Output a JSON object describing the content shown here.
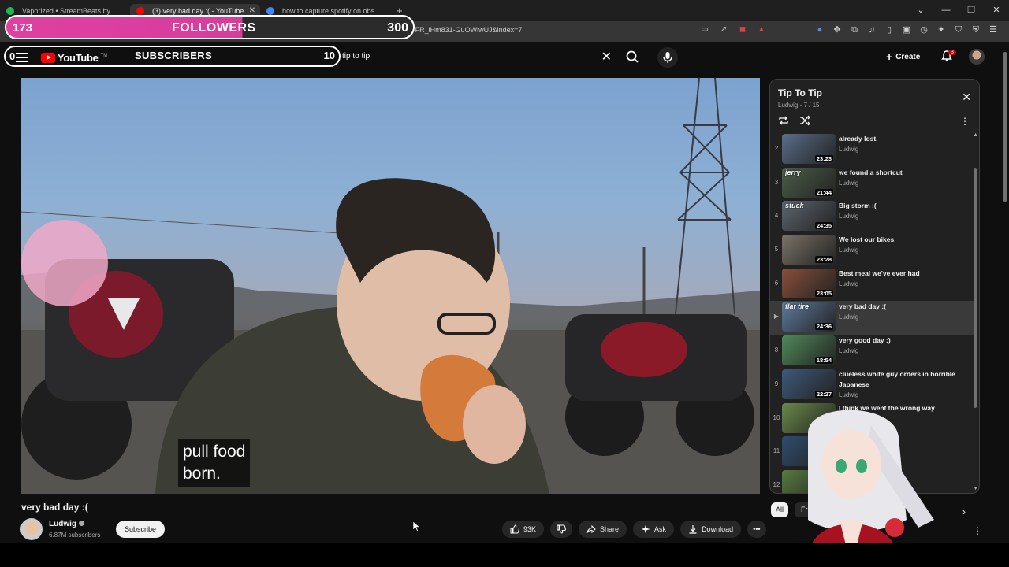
{
  "browser": {
    "tabs": [
      {
        "title": "Vaporized • StreamBeats by Harri",
        "fav_color": "#1db954",
        "active": false
      },
      {
        "title": "(3) very bad day :( - YouTube",
        "fav_color": "#ff0000",
        "active": true
      },
      {
        "title": "how to capture spotify on obs - Goo",
        "fav_color": "#4285f4",
        "active": false
      }
    ],
    "url": "be.com/watch?v=0yj7sQqq3nY&list=PLLGT0cbnpCyg_YFR_iHm831-GuOWlwUJ&index=7"
  },
  "overlay": {
    "followers_count": "173",
    "followers_label": "FOLLOWERS",
    "followers_goal": "300",
    "followers_progress": 0.58,
    "subs_count": "0",
    "subs_label": "SUBSCRIBERS",
    "subs_goal": "10"
  },
  "masthead": {
    "logo_text": "YouTube",
    "logo_tm": "TM",
    "search_value": "tip to tip",
    "create_label": "Create",
    "notif_count": "3"
  },
  "video": {
    "caption_line1": "pull food",
    "caption_line2": "born.",
    "title": "very bad day :(",
    "channel": "Ludwig",
    "subscribers": "6.87M subscribers",
    "subscribe_label": "Subscribe",
    "likes": "93K",
    "share_label": "Share",
    "ask_label": "Ask",
    "download_label": "Download"
  },
  "playlist": {
    "title": "Tip To Tip",
    "subtitle": "Ludwig - 7 / 15",
    "items": [
      {
        "index": "2",
        "title": "already lost.",
        "author": "Ludwig",
        "duration": "23:23",
        "thumb_text": "",
        "bg": "#5a6e8a",
        "current": false
      },
      {
        "index": "3",
        "title": "we found a shortcut",
        "author": "Ludwig",
        "duration": "21:44",
        "thumb_text": "jerry",
        "bg": "#4c5f4a",
        "current": false
      },
      {
        "index": "4",
        "title": "Big storm :(",
        "author": "Ludwig",
        "duration": "24:35",
        "thumb_text": "stuck",
        "bg": "#5d6670",
        "current": false
      },
      {
        "index": "5",
        "title": "We lost our bikes",
        "author": "Ludwig",
        "duration": "23:28",
        "thumb_text": "",
        "bg": "#7a7368",
        "current": false
      },
      {
        "index": "6",
        "title": "Best meal we've ever had",
        "author": "Ludwig",
        "duration": "23:05",
        "thumb_text": "",
        "bg": "#8a4f3a",
        "current": false
      },
      {
        "index": "▶",
        "title": "very bad day :(",
        "author": "Ludwig",
        "duration": "24:36",
        "thumb_text": "flat tire",
        "bg": "#5e7b9e",
        "current": true
      },
      {
        "index": "8",
        "title": "very good day :)",
        "author": "Ludwig",
        "duration": "18:54",
        "thumb_text": "",
        "bg": "#4f8a5a",
        "current": false
      },
      {
        "index": "9",
        "title": "clueless white guy orders in horrible Japanese",
        "author": "Ludwig",
        "duration": "22:27",
        "thumb_text": "",
        "bg": "#3d5a7a",
        "current": false
      },
      {
        "index": "10",
        "title": "I think we went the wrong way",
        "author": "",
        "duration": "",
        "thumb_text": "",
        "bg": "#6a8a4a",
        "current": false
      },
      {
        "index": "11",
        "title": "",
        "author": "",
        "duration": "",
        "thumb_text": "",
        "bg": "#2e4d6e",
        "current": false
      },
      {
        "index": "12",
        "title": "",
        "author": "",
        "duration": "",
        "thumb_text": "",
        "bg": "#587a3e",
        "current": false
      }
    ]
  },
  "chips": {
    "all": "All",
    "second": "Fr"
  },
  "colors": {
    "accent_red": "#ff0000",
    "followers_bar": "#e040a0",
    "bg": "#0f0f0f"
  }
}
